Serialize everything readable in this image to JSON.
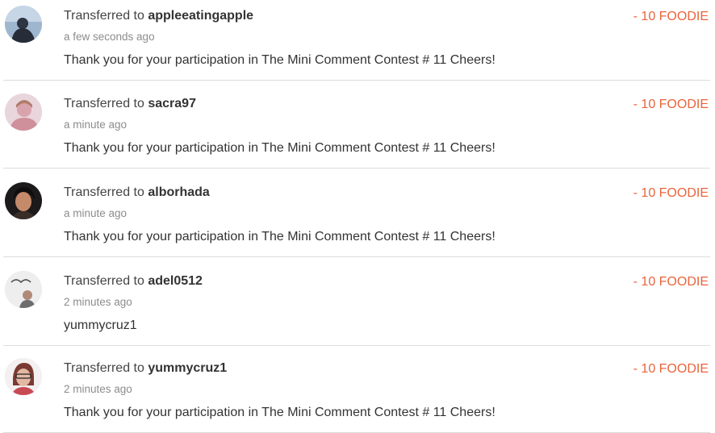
{
  "transfers": [
    {
      "prefix": "Transferred to",
      "recipient": "appleeatingapple",
      "time": "a few seconds ago",
      "memo": "Thank you for your participation in The Mini Comment Contest # 11 Cheers!",
      "amount": "- 10 FOODIE",
      "avatar": "user-avatar-icon"
    },
    {
      "prefix": "Transferred to",
      "recipient": "sacra97",
      "time": "a minute ago",
      "memo": "Thank you for your participation in The Mini Comment Contest # 11 Cheers!",
      "amount": "- 10 FOODIE",
      "avatar": "user-avatar-icon"
    },
    {
      "prefix": "Transferred to",
      "recipient": "alborhada",
      "time": "a minute ago",
      "memo": "Thank you for your participation in The Mini Comment Contest # 11 Cheers!",
      "amount": "- 10 FOODIE",
      "avatar": "user-avatar-icon"
    },
    {
      "prefix": "Transferred to",
      "recipient": "adel0512",
      "time": "2 minutes ago",
      "memo": "yummycruz1",
      "amount": "- 10 FOODIE",
      "avatar": "user-avatar-icon"
    },
    {
      "prefix": "Transferred to",
      "recipient": "yummycruz1",
      "time": "2 minutes ago",
      "memo": "Thank you for your participation in The Mini Comment Contest # 11 Cheers!",
      "amount": "- 10 FOODIE",
      "avatar": "user-avatar-icon"
    }
  ],
  "colors": {
    "amount": "#e8643c",
    "timestamp": "#8c8c8c",
    "divider": "#dcdcdc"
  }
}
